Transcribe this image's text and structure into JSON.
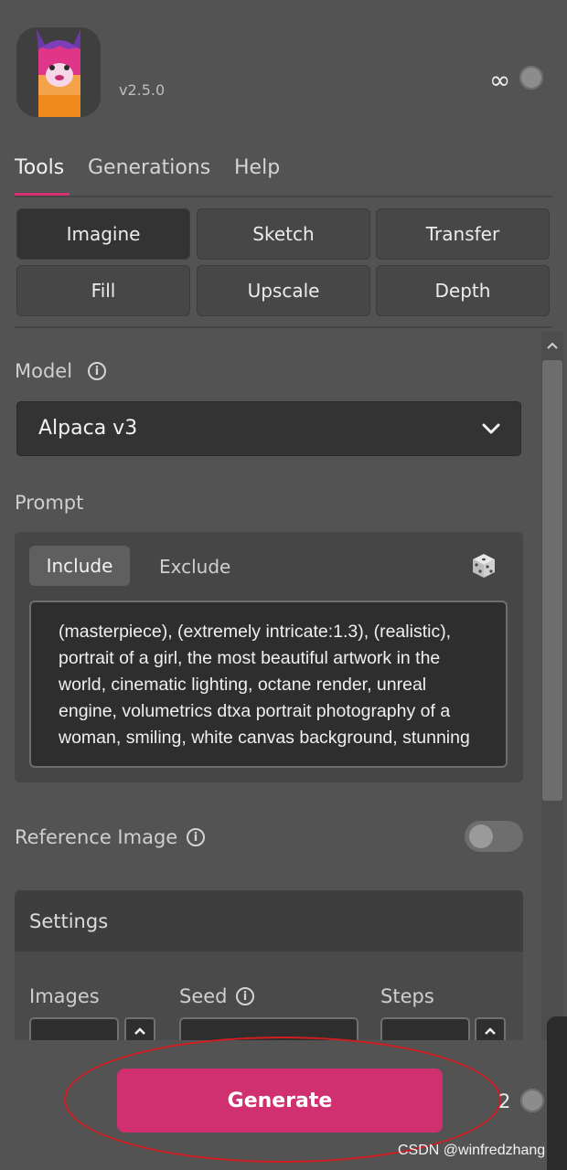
{
  "header": {
    "version": "v2.5.0",
    "infinity_symbol": "∞",
    "logo_icon": "alpaca-logo-icon"
  },
  "nav_tabs": [
    {
      "label": "Tools",
      "active": true
    },
    {
      "label": "Generations",
      "active": false
    },
    {
      "label": "Help",
      "active": false
    }
  ],
  "tools": [
    {
      "label": "Imagine",
      "selected": true
    },
    {
      "label": "Sketch",
      "selected": false
    },
    {
      "label": "Transfer",
      "selected": false
    },
    {
      "label": "Fill",
      "selected": false
    },
    {
      "label": "Upscale",
      "selected": false
    },
    {
      "label": "Depth",
      "selected": false
    }
  ],
  "model": {
    "label": "Model",
    "selected_value": "Alpaca v3"
  },
  "prompt": {
    "label": "Prompt",
    "mode_include": "Include",
    "mode_exclude": "Exclude",
    "text": "(masterpiece), (extremely intricate:1.3), (realistic), portrait of a girl, the most beautiful artwork in the world, cinematic lighting, octane render, unreal engine, volumetrics dtxa portrait photography of a woman, smiling, white canvas background, stunning"
  },
  "reference_image": {
    "label": "Reference Image",
    "enabled": false
  },
  "settings": {
    "title": "Settings",
    "images_label": "Images",
    "seed_label": "Seed",
    "steps_label": "Steps"
  },
  "footer": {
    "generate_label": "Generate",
    "count": "2",
    "watermark": "CSDN @winfredzhang"
  },
  "colors": {
    "accent": "#d02f70",
    "background": "#535353",
    "annotation": "#d11c20"
  }
}
